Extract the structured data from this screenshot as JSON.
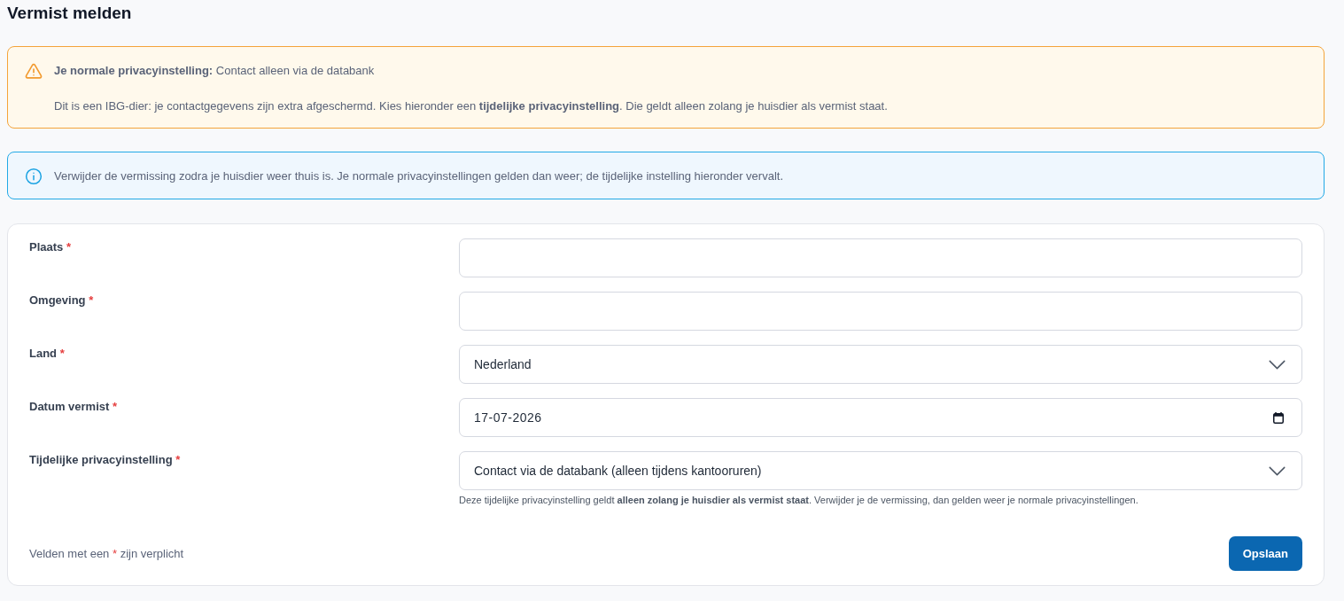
{
  "page": {
    "title": "Vermist melden"
  },
  "alerts": [
    {
      "kind": "warning",
      "lines": [
        "**Je normale privacyinstelling:** Contact alleen via de databank",
        "Dit is een IBG-dier: je contactgegevens zijn extra afgeschermd. Kies hieronder een **tijdelijke privacyinstelling**. Die geldt alleen zolang je huisdier als vermist staat."
      ]
    },
    {
      "kind": "info",
      "lines": [
        "Verwijder de vermissing zodra je huisdier weer thuis is. Je normale privacyinstellingen gelden dan weer; de tijdelijke instelling hieronder vervalt."
      ]
    }
  ],
  "form": {
    "fields": [
      {
        "label": "Plaats",
        "required_mark": "*",
        "kind": "text"
      },
      {
        "label": "Omgeving",
        "required_mark": "*",
        "kind": "text"
      },
      {
        "label": "Land",
        "required_mark": "*",
        "kind": "select",
        "value": "Nederland"
      },
      {
        "label": "Datum vermist",
        "required_mark": "*",
        "kind": "date",
        "value": "17-07-2026"
      },
      {
        "label": "Tijdelijke privacyinstelling",
        "required_mark": "*",
        "kind": "select",
        "value": "Contact via de databank (alleen tijdens kantooruren)",
        "help": "Deze tijdelijke privacyinstelling geldt **alleen zolang je huisdier als vermist staat**. Verwijder je de vermissing, dan gelden weer je normale privacyinstellingen."
      }
    ],
    "required_note": {
      "before": "Velden met een",
      "mark": "*",
      "after": "zijn verplicht"
    },
    "submit_button": "Opslaan"
  }
}
